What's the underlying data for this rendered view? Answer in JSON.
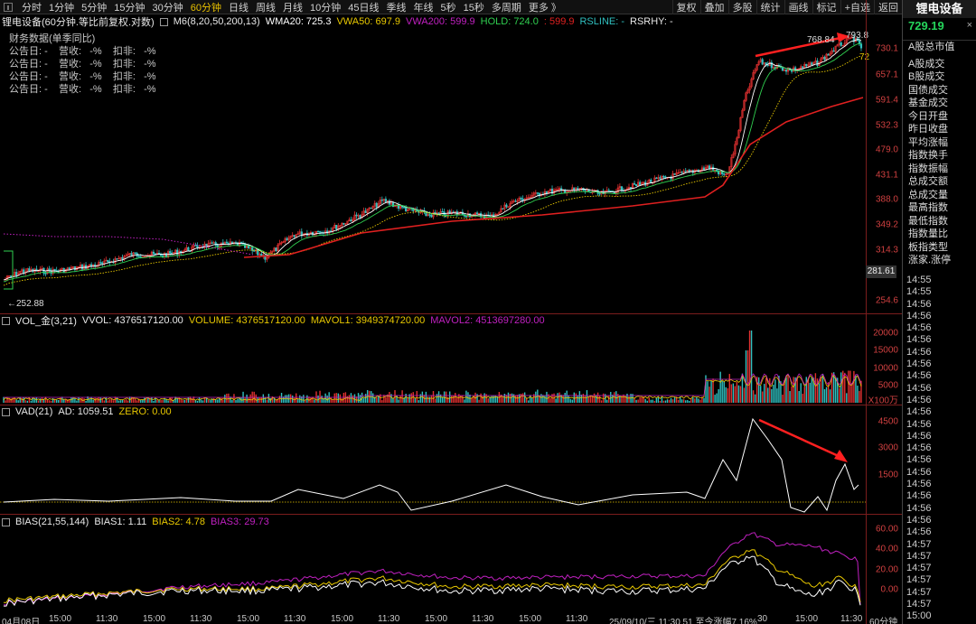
{
  "toolbar": {
    "periods": [
      "分时",
      "1分钟",
      "5分钟",
      "15分钟",
      "30分钟",
      "60分钟",
      "日线",
      "周线",
      "月线",
      "10分钟",
      "45日线",
      "季线",
      "年线",
      "5秒",
      "15秒",
      "多周期",
      "更多 》"
    ],
    "active_period": "60分钟",
    "right_buttons": [
      "复权",
      "叠加",
      "多股",
      "统计",
      "画线",
      "标记",
      "+自选",
      "返回"
    ]
  },
  "info": {
    "stock": "锂电设备(60分钟.等比前复权.对数)",
    "m6": "M6(8,20,50,200,13)",
    "wma20": "WMA20: 725.3",
    "vwa50": "VWA50: 697.9",
    "vwa200": "VWA200: 599.9",
    "hold": "HOLD: 724.0",
    "rs1": ": 599.9",
    "rsline": "RSLINE: -",
    "rsrhy": "RSRHY: -"
  },
  "financial": {
    "title": "财务数据(单季同比)",
    "rows": [
      "公告日: -    营收:   -%    扣非:   -%",
      "公告日: -    营收:   -%    扣非:   -%",
      "公告日: -    营收:   -%    扣非:   -%",
      "公告日: -    营收:   -%    扣非:   -%"
    ]
  },
  "right_panel": {
    "title": "锂电设备",
    "price": "729.19",
    "close_icon": "close-x",
    "menu": [
      "A股总市值",
      "A股成交",
      "B股成交",
      "国债成交",
      "基金成交",
      "今日开盘",
      "昨日收盘",
      "平均涨幅",
      "指数换手",
      "指数振幅",
      "总成交额",
      "总成交量",
      "最高指数",
      "最低指数",
      "指数量比",
      "板指类型",
      "涨家.涨停"
    ],
    "times": [
      "14:55",
      "14:55",
      "14:56",
      "14:56",
      "14:56",
      "14:56",
      "14:56",
      "14:56",
      "14:56",
      "14:56",
      "14:56",
      "14:56",
      "14:56",
      "14:56",
      "14:56",
      "14:56",
      "14:56",
      "14:56",
      "14:56",
      "14:56",
      "14:56",
      "14:56",
      "14:57",
      "14:57",
      "14:57",
      "14:57",
      "14:57",
      "14:57",
      "15:00",
      "14:57"
    ]
  },
  "price_axis": [
    "730.1",
    "657.1",
    "591.4",
    "532.3",
    "479.0",
    "431.1",
    "388.0",
    "349.2",
    "314.3",
    "254.6"
  ],
  "price_labels": {
    "high": "793.8",
    "high_left": "768.84",
    "low": "252.88",
    "last_box": "281.61",
    "ma_tag": "72"
  },
  "volume": {
    "header": [
      "VOL_金(3,21)",
      "VVOL: 4376517120.00",
      "VOLUME: 4376517120.00",
      "MAVOL1: 3949374720.00",
      "MAVOL2: 4513697280.00"
    ],
    "axis": [
      "20000",
      "15000",
      "10000",
      "5000"
    ],
    "unit": "X100万"
  },
  "vad": {
    "header": [
      "VAD(21)",
      "AD: 1059.51",
      "ZERO: 0.00"
    ],
    "axis": [
      "4500",
      "3000",
      "1500"
    ]
  },
  "bias": {
    "header": [
      "BIAS(21,55,144)",
      "BIAS1: 1.11",
      "BIAS2: 4.78",
      "BIAS3: 29.73"
    ],
    "axis": [
      "60.00",
      "40.00",
      "20.00",
      "0.00"
    ]
  },
  "xaxis": {
    "labels": [
      "04月08日",
      "15:00",
      "11:30",
      "15:00",
      "11:30",
      "15:00",
      "11:30",
      "15:00",
      "11:30",
      "15:00",
      "11:30",
      "15:00",
      "11:30",
      "15:00",
      "11:30",
      "25/09/10/三 11:30 51 至今涨幅7.16%",
      "30",
      "15:00",
      "11:30"
    ],
    "period": "60分钟"
  },
  "colors": {
    "up": "#e03030",
    "down": "#30c0c0",
    "ma_white": "#ffffff",
    "ma_yellow": "#e8c800",
    "ma_green": "#30d050",
    "ma_red": "#e02020",
    "purple": "#c020c0"
  }
}
